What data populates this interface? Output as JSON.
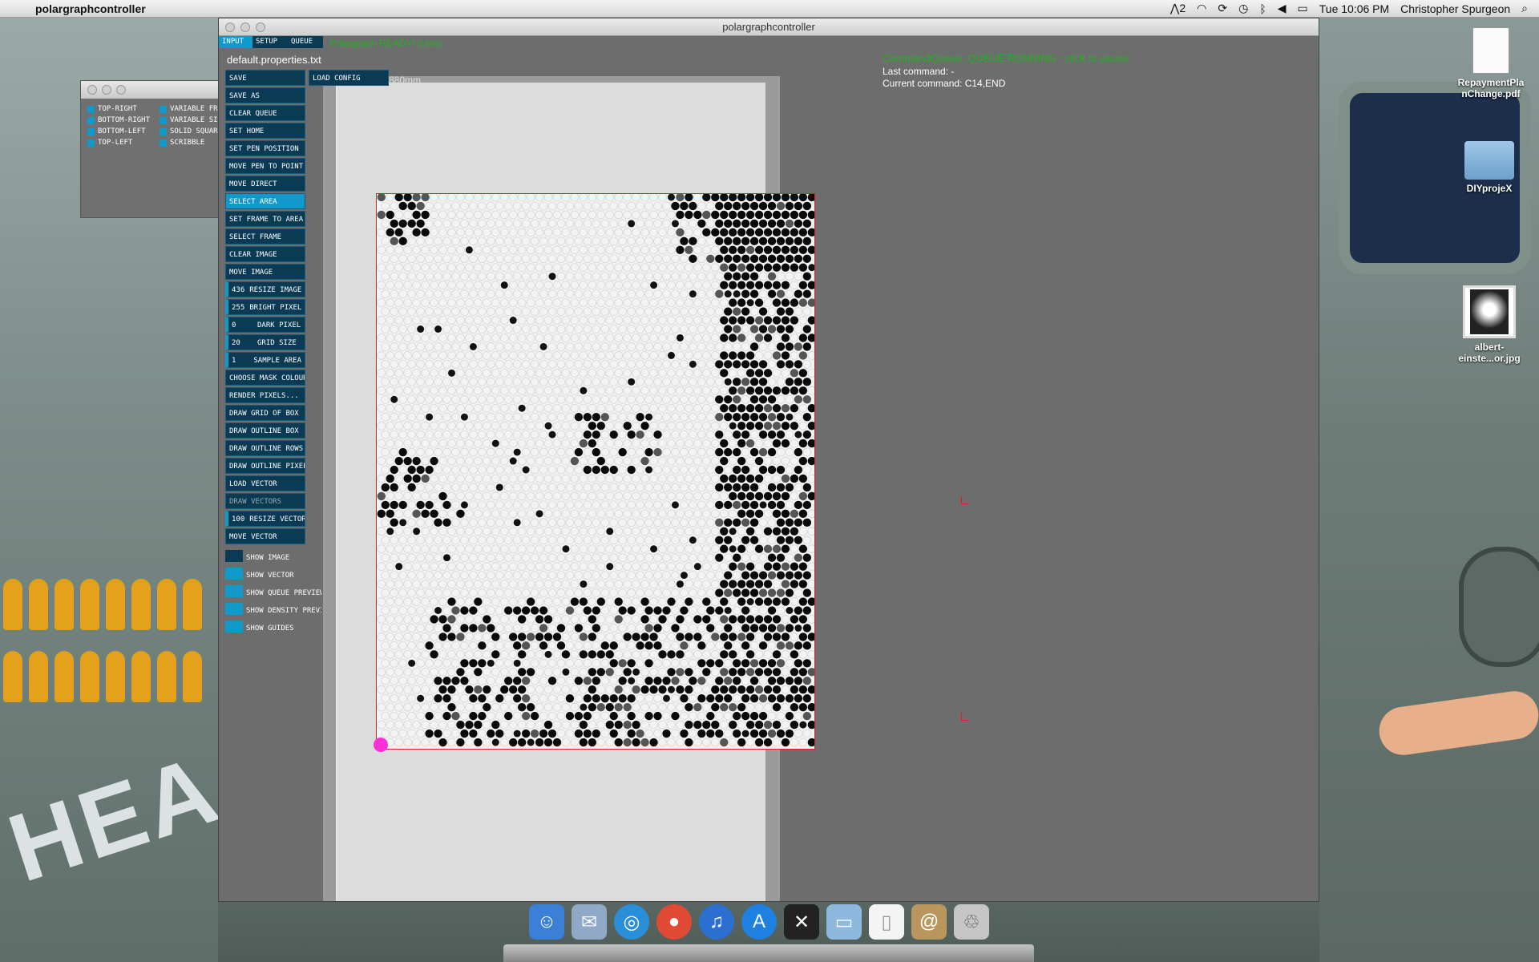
{
  "menubar": {
    "apple": "",
    "app_name": "polargraphcontroller",
    "status_num": "2",
    "clock": "Tue 10:06 PM",
    "user": "Christopher Spurgeon"
  },
  "small_window": {
    "options": [
      "TOP-RIGHT",
      "VARIABLE FRE",
      "BOTTOM-RIGHT",
      "VARIABLE SIZE",
      "BOTTOM-LEFT",
      "SOLID SQUARE",
      "TOP-LEFT",
      "SCRIBBLE"
    ]
  },
  "main_window": {
    "title": "polargraphcontroller",
    "tabs": [
      "INPUT",
      "SETUP",
      "QUEUE"
    ],
    "status": "Polargraph READY! (Uno)",
    "properties_file": "default.properties.txt",
    "load_config": "LOAD CONFIG",
    "size_label": "880mm",
    "buttons": [
      {
        "label": "SAVE"
      },
      {
        "label": "SAVE AS"
      },
      {
        "label": "CLEAR QUEUE"
      },
      {
        "label": "SET HOME"
      },
      {
        "label": "SET PEN POSITION"
      },
      {
        "label": "MOVE PEN TO POINT"
      },
      {
        "label": "MOVE DIRECT"
      },
      {
        "label": "SELECT AREA"
      },
      {
        "label": "SET FRAME TO AREA"
      },
      {
        "label": "SELECT FRAME"
      },
      {
        "label": "CLEAR IMAGE"
      },
      {
        "label": "MOVE IMAGE"
      },
      {
        "label": "RESIZE IMAGE",
        "value": "436"
      },
      {
        "label": "BRIGHT PIXEL",
        "value": "255"
      },
      {
        "label": "DARK PIXEL",
        "value": "0"
      },
      {
        "label": "GRID SIZE",
        "value": "20"
      },
      {
        "label": "SAMPLE AREA",
        "value": "1"
      },
      {
        "label": "CHOOSE MASK COLOUR"
      },
      {
        "label": "RENDER PIXELS..."
      },
      {
        "label": "DRAW GRID OF BOX"
      },
      {
        "label": "DRAW OUTLINE BOX"
      },
      {
        "label": "DRAW OUTLINE ROWS"
      },
      {
        "label": "DRAW OUTLINE PIXELS"
      },
      {
        "label": "LOAD VECTOR"
      },
      {
        "label": "DRAW VECTORS"
      },
      {
        "label": "RESIZE VECTOR",
        "value": "100"
      },
      {
        "label": "MOVE VECTOR"
      }
    ],
    "toggles": [
      {
        "label": "SHOW IMAGE",
        "on": false
      },
      {
        "label": "SHOW VECTOR",
        "on": true
      },
      {
        "label": "SHOW QUEUE PREVIEW",
        "on": true
      },
      {
        "label": "SHOW DENSITY PREVIEW",
        "on": true
      },
      {
        "label": "SHOW GUIDES",
        "on": true
      }
    ],
    "command_queue": "CommandQueue: QUEUE RUNNING - click to pause",
    "last_command": "Last command: -",
    "current_command": "Current command: C14,END"
  },
  "desktop_icons": [
    {
      "name": "RepaymentPlanChange.pdf",
      "line1": "RepaymentPla",
      "line2": "nChange.pdf"
    },
    {
      "name": "DIYprojeX",
      "line1": "DIYprojeX",
      "line2": ""
    },
    {
      "name": "albert-einste...or.jpg",
      "line1": "albert-",
      "line2": "einste...or.jpg"
    }
  ],
  "dock": {
    "apps": [
      "finder-icon",
      "mail-icon",
      "safari-icon",
      "chrome-icon",
      "itunes-icon",
      "appstore-icon",
      "polargraph-icon",
      "folder-icon",
      "document-icon",
      "contacts-icon",
      "trash-icon"
    ]
  },
  "colors": {
    "button_bg": "#0b3a55",
    "button_active": "#1199cc",
    "status_green": "#21b021",
    "frame_red": "#e02020",
    "home_marker": "#ff2fd8"
  }
}
